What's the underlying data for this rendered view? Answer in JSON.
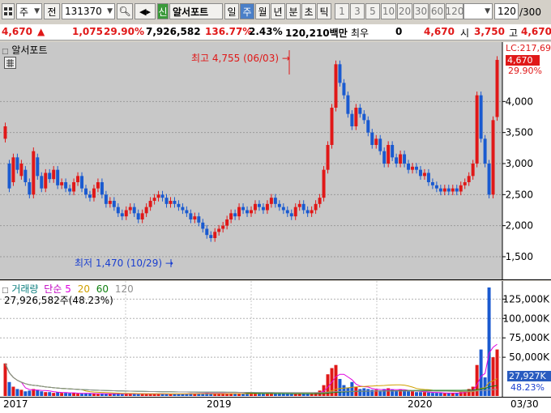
{
  "toolbar": {
    "market": "주",
    "period": "전",
    "code": "131370",
    "credit_badge": "신",
    "stock_name": "알서포트",
    "intervals": [
      "일",
      "주",
      "월",
      "년",
      "분",
      "초",
      "틱"
    ],
    "active_interval": "주",
    "multipliers": [
      "1",
      "3",
      "5",
      "10",
      "20",
      "30",
      "60",
      "120"
    ],
    "count": "120",
    "count_total": "/300"
  },
  "quote": {
    "price": "4,670",
    "change": "1,075",
    "change_rate": "29.90%",
    "volume": "7,926,582",
    "volume_rate": "136.77%",
    "turnover": "2.43%",
    "amount": "120,210백만",
    "label_choi": "최우",
    "choi_value": "0",
    "price2": "4,670",
    "open_label": "시",
    "open": "3,750",
    "high_label": "고",
    "high": "4,670"
  },
  "price_panel": {
    "title": "알서포트",
    "lc_label": "LC:217,69",
    "last_price_tag": "4,670",
    "last_rate_tag": "29.90%",
    "high_annotation": "최고 4,755 (06/03)",
    "low_annotation": "최저 1,470 (10/29)",
    "y_ticks": [
      "4,000",
      "3,500",
      "3,000",
      "2,500",
      "2,000",
      "1,500"
    ]
  },
  "volume_panel": {
    "title": "거래량",
    "ma_label": "단순",
    "ma_periods": [
      "5",
      "20",
      "60",
      "120"
    ],
    "ma_colors": [
      "#e000e0",
      "#d0a000",
      "#108010",
      "#909090"
    ],
    "info": "27,926,582주(48.23%)",
    "y_ticks": [
      "125,000K",
      "100,000K",
      "75,000K",
      "50,000K"
    ],
    "last_tag": "27,927K",
    "last_rate": "48.23%"
  },
  "x_axis": {
    "labels": [
      "2017",
      "2019",
      "2020"
    ],
    "date_label": "03/30"
  },
  "chart_data": {
    "type": "candlestick",
    "interval": "weekly",
    "price_range": [
      1200,
      4800
    ],
    "volume_range": [
      0,
      140000
    ],
    "closes": [
      3600,
      2600,
      3100,
      2900,
      3000,
      2700,
      2500,
      3200,
      2800,
      2600,
      2850,
      2750,
      2900,
      2650,
      2700,
      2600,
      2550,
      2700,
      2800,
      2600,
      2500,
      2450,
      2600,
      2700,
      2500,
      2350,
      2400,
      2300,
      2200,
      2150,
      2250,
      2300,
      2200,
      2100,
      2200,
      2300,
      2400,
      2450,
      2500,
      2450,
      2350,
      2400,
      2350,
      2300,
      2250,
      2200,
      2100,
      2150,
      2050,
      1950,
      1850,
      1800,
      1900,
      1950,
      2000,
      2100,
      2200,
      2150,
      2300,
      2250,
      2200,
      2250,
      2350,
      2300,
      2250,
      2350,
      2450,
      2350,
      2300,
      2250,
      2200,
      2150,
      2300,
      2350,
      2250,
      2200,
      2250,
      2350,
      2450,
      2900,
      3300,
      3900,
      4600,
      4300,
      4100,
      3800,
      3600,
      3900,
      3800,
      3700,
      3500,
      3300,
      3400,
      3200,
      3000,
      3300,
      3100,
      3000,
      3150,
      3000,
      2900,
      2950,
      2900,
      2800,
      2850,
      2700,
      2650,
      2600,
      2550,
      2600,
      2550,
      2600,
      2550,
      2650,
      2700,
      2800,
      3000,
      4100,
      3400,
      3000,
      2500,
      3700,
      4670
    ],
    "opens": [
      3400,
      3000,
      2700,
      3100,
      2800,
      2900,
      2700,
      2500,
      3100,
      2800,
      2600,
      2850,
      2750,
      2900,
      2650,
      2700,
      2600,
      2550,
      2700,
      2800,
      2600,
      2500,
      2450,
      2600,
      2700,
      2500,
      2350,
      2400,
      2300,
      2200,
      2150,
      2250,
      2300,
      2200,
      2100,
      2200,
      2300,
      2400,
      2450,
      2500,
      2450,
      2350,
      2400,
      2350,
      2300,
      2250,
      2200,
      2100,
      2150,
      2050,
      1950,
      1850,
      1800,
      1900,
      1950,
      2000,
      2100,
      2200,
      2150,
      2300,
      2250,
      2200,
      2250,
      2350,
      2300,
      2250,
      2350,
      2450,
      2350,
      2300,
      2250,
      2200,
      2150,
      2300,
      2350,
      2250,
      2200,
      2250,
      2350,
      2450,
      2900,
      3300,
      3900,
      4600,
      4300,
      4100,
      3800,
      3600,
      3900,
      3800,
      3700,
      3500,
      3300,
      3400,
      3200,
      3000,
      3300,
      3100,
      3000,
      3150,
      3000,
      2900,
      2950,
      2900,
      2800,
      2850,
      2700,
      2650,
      2600,
      2550,
      2600,
      2550,
      2600,
      2550,
      2650,
      2700,
      2800,
      3000,
      4100,
      3400,
      3000,
      2500,
      3750
    ],
    "volumes": [
      42000,
      18000,
      12000,
      9000,
      8000,
      6000,
      7000,
      9000,
      8000,
      6000,
      5000,
      5000,
      4000,
      5000,
      4000,
      4000,
      3500,
      4000,
      3000,
      3000,
      3500,
      3000,
      3000,
      2500,
      3000,
      3000,
      2500,
      3000,
      3000,
      2500,
      3000,
      3000,
      2500,
      2500,
      3000,
      3000,
      2500,
      2500,
      2500,
      3000,
      2500,
      2500,
      2500,
      2500,
      3000,
      3000,
      3500,
      3000,
      3000,
      3500,
      4000,
      3500,
      3000,
      3000,
      3000,
      3000,
      3500,
      3000,
      3000,
      3000,
      3000,
      3000,
      3500,
      3000,
      3000,
      3000,
      3500,
      3000,
      3000,
      3000,
      3000,
      3000,
      3000,
      3500,
      3000,
      3000,
      3500,
      4000,
      7000,
      14000,
      28000,
      36000,
      40000,
      22000,
      14000,
      11000,
      18000,
      12000,
      9000,
      10000,
      9000,
      8000,
      8000,
      7000,
      9000,
      10000,
      8000,
      7000,
      8000,
      7000,
      6000,
      6000,
      5000,
      5000,
      5000,
      4500,
      4000,
      4000,
      4000,
      3500,
      3500,
      4000,
      4000,
      5000,
      6000,
      9000,
      12000,
      40000,
      60000,
      24000,
      140000,
      50000,
      60000,
      27927
    ]
  }
}
